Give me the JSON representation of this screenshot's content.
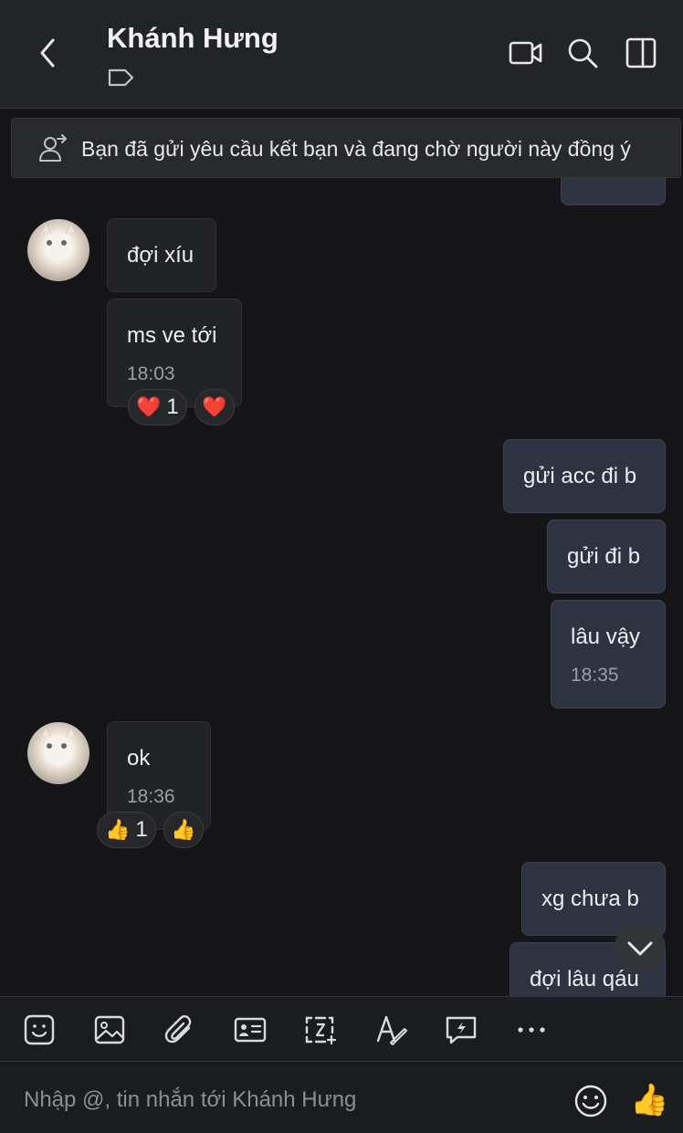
{
  "header": {
    "title": "Khánh Hưng",
    "icons": [
      "back-icon",
      "tag-icon",
      "video-call-icon",
      "search-icon",
      "sidebar-panel-icon"
    ]
  },
  "banner": {
    "text": "Bạn đã gửi yêu cầu kết bạn và đang chờ người này đồng ý",
    "icon": "add-friend-pending-icon"
  },
  "messages": [
    {
      "direction": "in",
      "text": "đợi xíu"
    },
    {
      "direction": "in",
      "text": "ms ve tới",
      "time": "18:03",
      "reactions": [
        {
          "emoji": "❤️",
          "count": "1"
        },
        {
          "emoji": "❤️"
        }
      ]
    },
    {
      "direction": "out",
      "text": "gửi acc đi b"
    },
    {
      "direction": "out",
      "text": "gửi đi b"
    },
    {
      "direction": "out",
      "text": "lâu vậy",
      "time": "18:35"
    },
    {
      "direction": "in",
      "text": "ok",
      "time": "18:36",
      "reactions": [
        {
          "emoji": "👍",
          "count": "1"
        },
        {
          "emoji": "👍"
        }
      ]
    },
    {
      "direction": "out",
      "text": "xg chưa b"
    },
    {
      "direction": "out",
      "text": "đợi lâu qáu"
    }
  ],
  "toolbar": {
    "items": [
      "sticker-icon",
      "image-icon",
      "attach-icon",
      "contact-card-icon",
      "screenshot-icon",
      "text-format-icon",
      "quick-message-icon",
      "more-icon"
    ]
  },
  "composer": {
    "placeholder": "Nhập @, tin nhắn tới Khánh Hưng",
    "quick_like": "👍"
  },
  "colors": {
    "background": "#151517",
    "header": "#232427",
    "incoming_bubble": "#222326",
    "outgoing_bubble": "#2d3340"
  }
}
